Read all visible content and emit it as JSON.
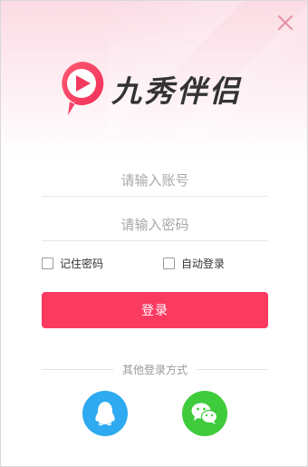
{
  "window": {
    "app_name": "九秀伴侣"
  },
  "login": {
    "account_placeholder": "请输入账号",
    "password_placeholder": "请输入密码",
    "remember_label": "记住密码",
    "autologin_label": "自动登录",
    "login_button": "登录",
    "other_methods": "其他登录方式"
  },
  "social": [
    {
      "name": "qq",
      "icon": "qq-penguin-icon",
      "color": "#2eaaf0"
    },
    {
      "name": "wechat",
      "icon": "wechat-icon",
      "color": "#3fcb3c"
    }
  ],
  "colors": {
    "accent": "#fb3a60",
    "close": "#e98fa8"
  }
}
